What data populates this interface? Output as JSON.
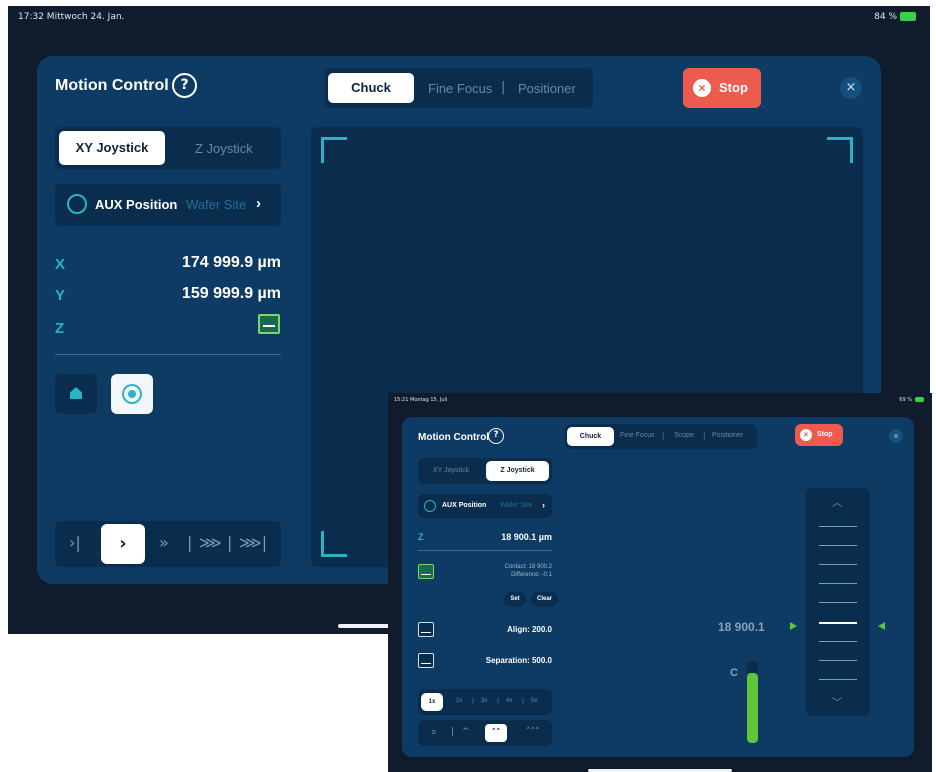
{
  "main": {
    "status_time": "17:32  Mittwoch 24. Jan.",
    "battery": "84 %",
    "title": "Motion Control",
    "help_icon": "?",
    "tabs": [
      "Chuck",
      "Fine Focus",
      "Positioner"
    ],
    "tab_separator": "|",
    "stop_label": "Stop",
    "close_icon": "×",
    "joystick_tabs": [
      "XY Joystick",
      "Z Joystick"
    ],
    "aux_label": "AUX Position",
    "aux_sub": "Wafer Site",
    "chevron": "›",
    "axes": {
      "x_label": "X",
      "x_value": "174 999.9 µm",
      "y_label": "Y",
      "y_value": "159 999.9 µm",
      "z_label": "Z"
    },
    "speed_glyphs": [
      "›|",
      "›",
      "»",
      "|",
      "⋙",
      "|",
      "⋙|"
    ]
  },
  "inset": {
    "status_time": "15:21  Montag 15. Juli",
    "battery": "69 %",
    "title": "Motion Control",
    "help_icon": "?",
    "tabs": [
      "Chuck",
      "Fine Focus",
      "Scope",
      "Positioner"
    ],
    "tab_separator": "|",
    "stop_label": "Stop",
    "close_icon": "×",
    "joystick_tabs": [
      "XY Joystick",
      "Z Joystick"
    ],
    "aux_label": "AUX Position",
    "aux_sub": "Wafer Site",
    "chevron": "›",
    "z_label": "Z",
    "z_value": "18 900.1 µm",
    "contact": "Contact: 18 900.2",
    "difference": "Difference: -0.1",
    "set_label": "Set",
    "clear_label": "Clear",
    "align": "Align: 200.0",
    "separation": "Separation: 500.0",
    "multipliers": [
      "1x",
      "2x",
      "3x",
      "4x",
      "5x"
    ],
    "step_glyphs": [
      "⌅",
      "^",
      "˄˄",
      "˄˄˄"
    ],
    "rail_up": "︿",
    "rail_down": "﹀",
    "z_readout": "18 900.1",
    "c_label": "C",
    "c_level": 0.85
  },
  "colors": {
    "panel": "#0d3b63",
    "accent_cyan": "#29b3c4",
    "stop_red": "#ec5b4d",
    "green": "#5fc63a"
  }
}
